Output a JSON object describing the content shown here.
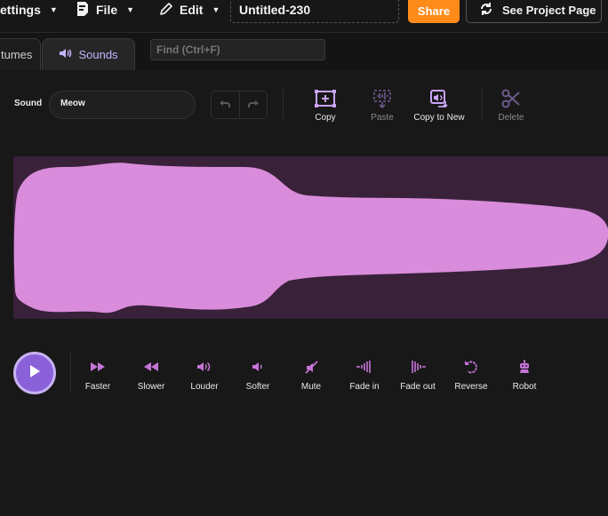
{
  "menu": {
    "settings_label": "ettings",
    "file_label": "File",
    "edit_label": "Edit",
    "project_title": "Untitled-230",
    "share_label": "Share",
    "see_project_label": "See Project Page"
  },
  "tabs": {
    "costumes_label": "tumes",
    "sounds_label": "Sounds"
  },
  "find": {
    "placeholder": "Find (Ctrl+F)"
  },
  "editor": {
    "sound_label": "Sound",
    "sound_name": "Meow",
    "tools": {
      "copy": "Copy",
      "paste": "Paste",
      "copy_to_new": "Copy to New",
      "delete": "Delete"
    }
  },
  "effects": {
    "faster": "Faster",
    "slower": "Slower",
    "louder": "Louder",
    "softer": "Softer",
    "mute": "Mute",
    "fade_in": "Fade in",
    "fade_out": "Fade out",
    "reverse": "Reverse",
    "robot": "Robot"
  },
  "colors": {
    "accent": "#8a61d9",
    "share": "#ff8c1a",
    "waveform": "#d98cdb",
    "waveform_bg": "#39213a",
    "effect_icon": "#c774d9"
  }
}
